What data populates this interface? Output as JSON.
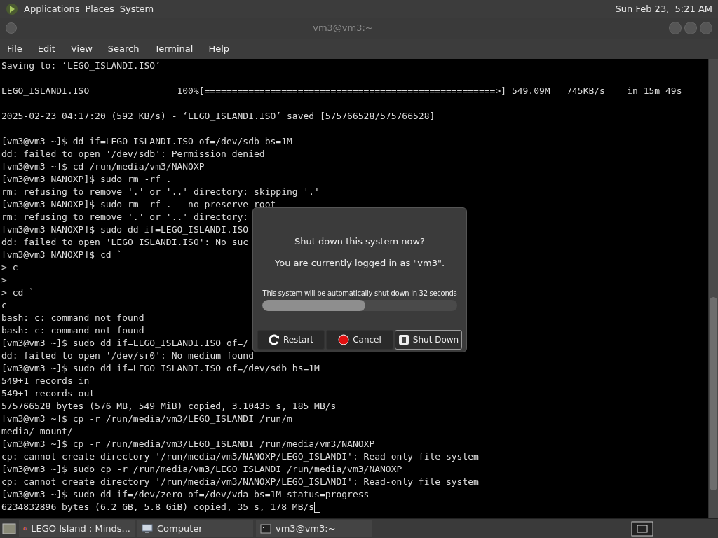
{
  "top_panel": {
    "menus": [
      "Applications",
      "Places",
      "System"
    ],
    "clock": "Sun Feb 23,  5:21 AM"
  },
  "window": {
    "title": "vm3@vm3:~"
  },
  "menu_bar": [
    "File",
    "Edit",
    "View",
    "Search",
    "Terminal",
    "Help"
  ],
  "terminal": {
    "blocks": [
      [
        "Saving to: ‘LEGO_ISLANDI.ISO’"
      ],
      [
        "LEGO_ISLANDI.ISO                100%[=====================================================>] 549.09M   745KB/s    in 15m 49s"
      ],
      [
        "2025-02-23 04:17:20 (592 KB/s) - ‘LEGO_ISLANDI.ISO’ saved [575766528/575766528]"
      ],
      [
        "[vm3@vm3 ~]$ dd if=LEGO_ISLANDI.ISO of=/dev/sdb bs=1M",
        "dd: failed to open '/dev/sdb': Permission denied",
        "[vm3@vm3 ~]$ cd /run/media/vm3/NANOXP",
        "[vm3@vm3 NANOXP]$ sudo rm -rf .",
        "rm: refusing to remove '.' or '..' directory: skipping '.'",
        "[vm3@vm3 NANOXP]$ sudo rm -rf . --no-preserve-root",
        "rm: refusing to remove '.' or '..' directory:",
        "[vm3@vm3 NANOXP]$ sudo dd if=LEGO_ISLANDI.ISO",
        "dd: failed to open 'LEGO_ISLANDI.ISO': No suc",
        "[vm3@vm3 NANOXP]$ cd `",
        "> c",
        ">",
        "> cd `",
        "c",
        "bash: c: command not found",
        "bash: c: command not found",
        "[vm3@vm3 ~]$ sudo dd if=LEGO_ISLANDI.ISO of=/",
        "dd: failed to open '/dev/sr0': No medium found",
        "[vm3@vm3 ~]$ sudo dd if=LEGO_ISLANDI.ISO of=/dev/sdb bs=1M",
        "549+1 records in",
        "549+1 records out",
        "575766528 bytes (576 MB, 549 MiB) copied, 3.10435 s, 185 MB/s",
        "[vm3@vm3 ~]$ cp -r /run/media/vm3/LEGO_ISLANDI /run/m",
        "media/ mount/",
        "[vm3@vm3 ~]$ cp -r /run/media/vm3/LEGO_ISLANDI /run/media/vm3/NANOXP",
        "cp: cannot create directory '/run/media/vm3/NANOXP/LEGO_ISLANDI': Read-only file system",
        "[vm3@vm3 ~]$ sudo cp -r /run/media/vm3/LEGO_ISLANDI /run/media/vm3/NANOXP",
        "cp: cannot create directory '/run/media/vm3/NANOXP/LEGO_ISLANDI': Read-only file system",
        "[vm3@vm3 ~]$ sudo dd if=/dev/zero of=/dev/vda bs=1M status=progress",
        "6234832896 bytes (6.2 GB, 5.8 GiB) copied, 35 s, 178 MB/s"
      ]
    ]
  },
  "dialog": {
    "question": "Shut down this system now?",
    "logged_in": "You are currently logged in as \"vm3\".",
    "countdown": "This system will be automatically shut down in 32 seconds",
    "level": 0.53,
    "buttons": [
      {
        "kind": "restart",
        "label": "Restart",
        "selected": false
      },
      {
        "kind": "cancel",
        "label": "Cancel",
        "selected": false
      },
      {
        "kind": "shutdown",
        "label": "Shut Down",
        "selected": true
      }
    ]
  },
  "taskbar": {
    "items": [
      {
        "kind": "browser",
        "label": "LEGO Island : Minds..."
      },
      {
        "kind": "computer",
        "label": "Computer"
      },
      {
        "kind": "terminal",
        "label": "vm3@vm3:~"
      }
    ]
  }
}
